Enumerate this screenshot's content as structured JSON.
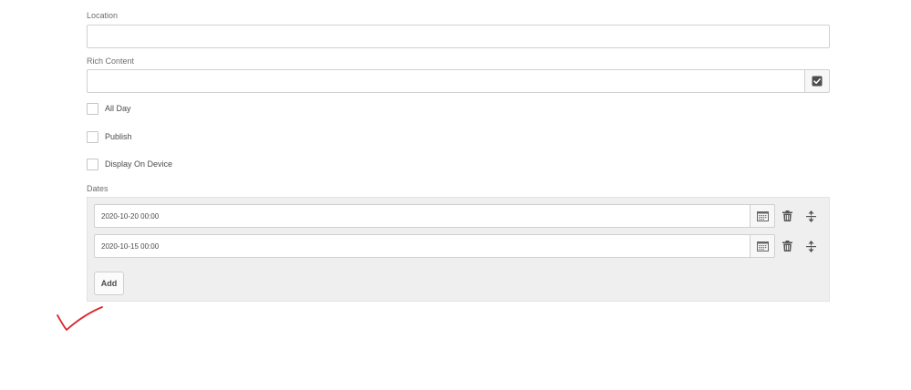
{
  "location": {
    "label": "Location",
    "value": "",
    "placeholder": ""
  },
  "rich_content": {
    "label": "Rich Content",
    "value": "",
    "button_icon": "check-square-icon"
  },
  "checkboxes": [
    {
      "label": "All Day",
      "checked": false
    },
    {
      "label": "Publish",
      "checked": false
    },
    {
      "label": "Display On Device",
      "checked": false
    }
  ],
  "dates": {
    "label": "Dates",
    "items": [
      {
        "value": "2020-10-20 00:00"
      },
      {
        "value": "2020-10-15 00:00"
      }
    ],
    "add_label": "Add"
  },
  "colors": {
    "annotation": "#d9262c",
    "panel_bg": "#efefef",
    "border": "#d0d0d0"
  }
}
